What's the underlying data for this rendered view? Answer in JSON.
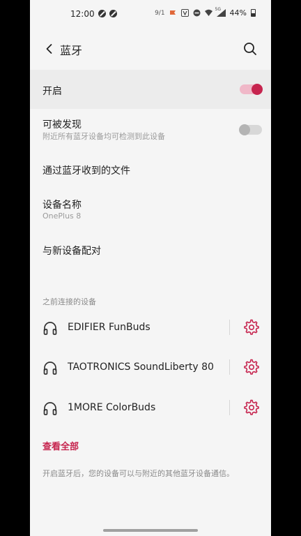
{
  "status_bar": {
    "time": "12:00",
    "indicator_text": "9/1",
    "network": "5G",
    "battery": "44%"
  },
  "header": {
    "title": "蓝牙"
  },
  "settings": {
    "enable": {
      "label": "开启",
      "on": true
    },
    "discoverable": {
      "label": "可被发现",
      "sub": "附近所有蓝牙设备均可检测到此设备",
      "on": false
    },
    "received_files": {
      "label": "通过蓝牙收到的文件"
    },
    "device_name": {
      "label": "设备名称",
      "value": "OnePlus 8"
    },
    "pair_new": {
      "label": "与新设备配对"
    }
  },
  "previous_devices": {
    "header": "之前连接的设备",
    "items": [
      {
        "name": "EDIFIER FunBuds"
      },
      {
        "name": "TAOTRONICS SoundLiberty 80"
      },
      {
        "name": "1MORE ColorBuds"
      }
    ],
    "view_all": "查看全部"
  },
  "footer_text": "开启蓝牙后，您的设备可以与附近的其他蓝牙设备通信。",
  "colors": {
    "accent": "#c6244e",
    "background": "#f5f5f5"
  }
}
